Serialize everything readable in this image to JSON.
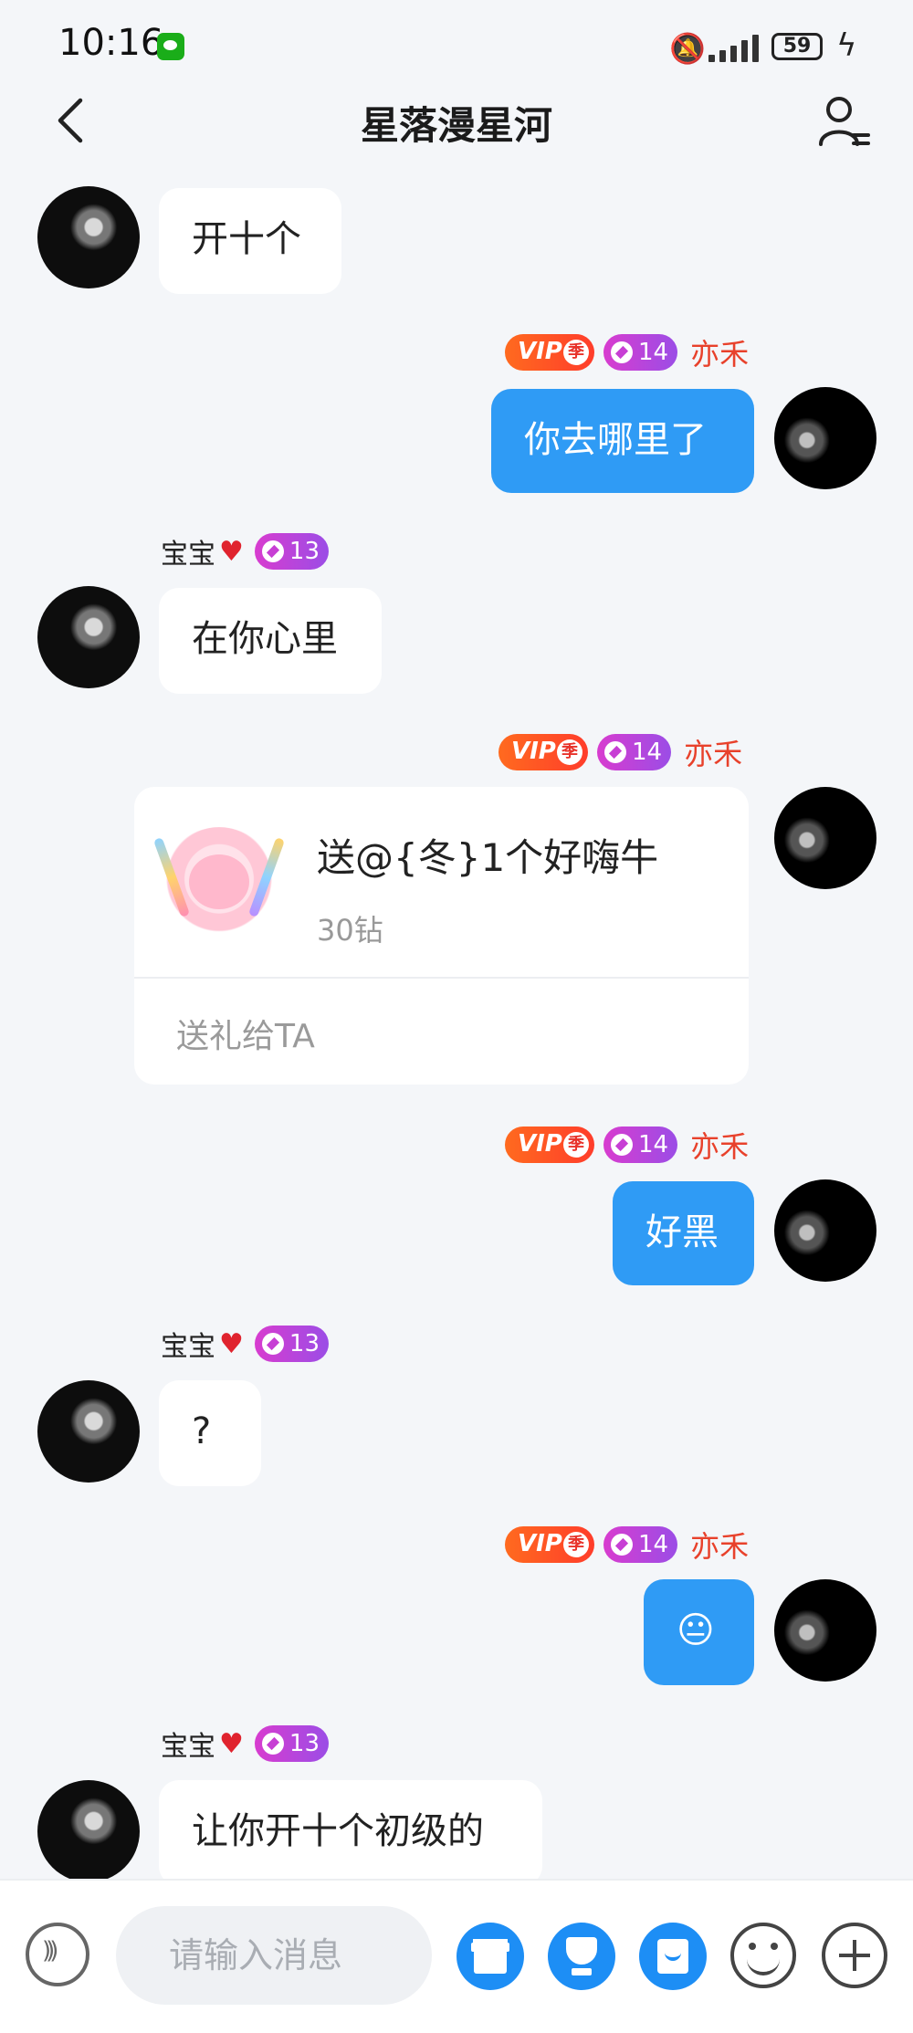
{
  "status_bar": {
    "time": "10:16",
    "battery": "59"
  },
  "header": {
    "title": "星落漫星河"
  },
  "badges": {
    "vip_text": "VIP",
    "vip_season": "季"
  },
  "messages": [
    {
      "side": "in",
      "text": "开十个"
    },
    {
      "side": "out",
      "name": "亦禾",
      "level": "14",
      "text": "你去哪里了"
    },
    {
      "side": "in",
      "name": "宝宝",
      "level": "13",
      "text": "在你心里"
    },
    {
      "side": "out",
      "name": "亦禾",
      "level": "14",
      "gift": {
        "title": "送@{冬}1个好嗨牛",
        "price": "30钻",
        "action": "送礼给TA"
      }
    },
    {
      "side": "out",
      "name": "亦禾",
      "level": "14",
      "text": "好黑"
    },
    {
      "side": "in",
      "name": "宝宝",
      "level": "13",
      "text": "?"
    },
    {
      "side": "out",
      "name": "亦禾",
      "level": "14",
      "text": "😐"
    },
    {
      "side": "in",
      "name": "宝宝",
      "level": "13",
      "text": "让你开十个初级的"
    }
  ],
  "input_bar": {
    "placeholder": "请输入消息"
  },
  "icons": {
    "back": "chevron-left-icon",
    "profile": "user-list-icon",
    "voice": "voice-icon",
    "gift": "gift-icon",
    "trophy": "trophy-icon",
    "envelope": "red-envelope-icon",
    "emoji": "emoji-icon",
    "plus": "plus-icon"
  },
  "colors": {
    "accent": "#2f9bf5",
    "vip": "#ff4b28",
    "level_badge": "#c23fd9",
    "out_name": "#e8412b"
  }
}
